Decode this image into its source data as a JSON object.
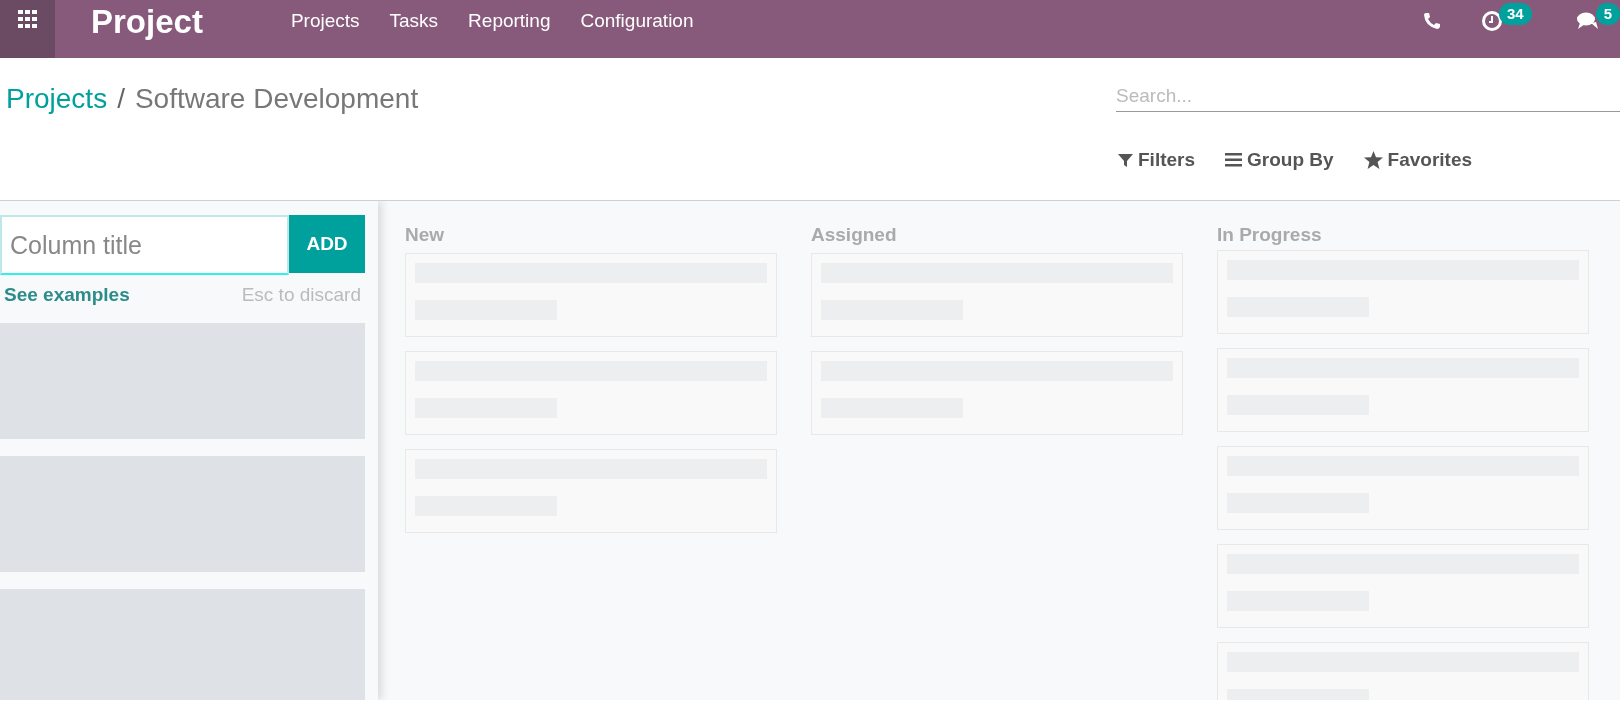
{
  "navbar": {
    "app_name": "Project",
    "menu": [
      "Projects",
      "Tasks",
      "Reporting",
      "Configuration"
    ],
    "systray": [
      {
        "kind": "phone"
      },
      {
        "kind": "activity",
        "badge": "34"
      },
      {
        "kind": "messages",
        "badge": "5"
      }
    ]
  },
  "breadcrumb": {
    "parent": "Projects",
    "separator": "/",
    "current": "Software Development"
  },
  "search": {
    "placeholder": "Search..."
  },
  "search_options": [
    {
      "kind": "filter",
      "label": "Filters"
    },
    {
      "kind": "group",
      "label": "Group By"
    },
    {
      "kind": "favorite",
      "label": "Favorites"
    }
  ],
  "quick_create_column": {
    "placeholder": "Column title",
    "add_button": "ADD",
    "examples_link": "See examples",
    "hint": "Esc to discard",
    "ghost_columns": [
      {
        "kind": "placeholder"
      },
      {
        "kind": "placeholder"
      },
      {
        "kind": "placeholder"
      }
    ]
  },
  "columns": [
    {
      "title": "New",
      "cards": [
        {
          "kind": "placeholder"
        },
        {
          "kind": "placeholder"
        },
        {
          "kind": "placeholder"
        }
      ]
    },
    {
      "title": "Assigned",
      "cards": [
        {
          "kind": "placeholder"
        },
        {
          "kind": "placeholder"
        }
      ]
    },
    {
      "title": "In Progress",
      "cards": [
        {
          "kind": "placeholder"
        },
        {
          "kind": "placeholder"
        },
        {
          "kind": "placeholder"
        },
        {
          "kind": "placeholder"
        },
        {
          "kind": "placeholder"
        }
      ]
    }
  ]
}
